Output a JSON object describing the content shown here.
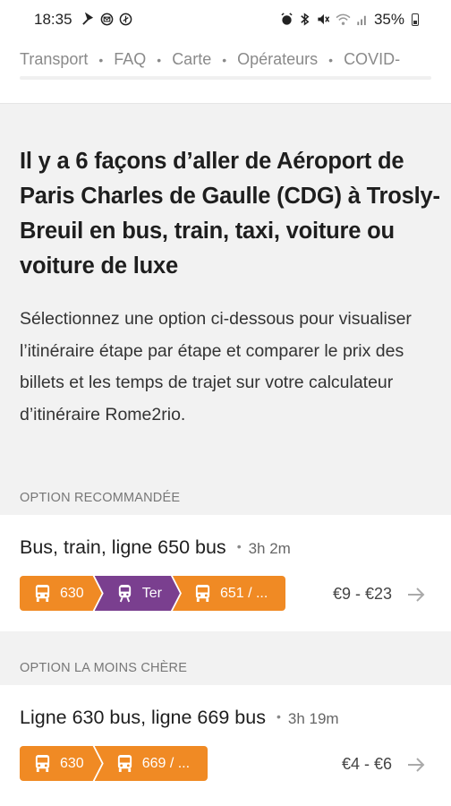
{
  "status_bar": {
    "time": "18:35",
    "left_icons": [
      "signal-tower-icon",
      "mail-icon",
      "sync-icon"
    ],
    "right_icons": [
      "alarm-icon",
      "bluetooth-icon",
      "mute-icon",
      "wifi-icon",
      "cell-signal-icon"
    ],
    "battery": "35%"
  },
  "nav": {
    "items": [
      "Transport",
      "FAQ",
      "Carte",
      "Opérateurs",
      "COVID-"
    ]
  },
  "headline": "Il y a 6 façons d’aller de Aéroport de Paris Charles de Gaulle (CDG) à Trosly-Breuil en bus, train, taxi, voiture ou voiture de luxe",
  "intro": "Sélectionnez une option ci-dessous pour visualiser l’itinéraire étape par étape et comparer le prix des billets et les temps de trajet sur votre calculateur d’itinéraire Rome2rio.",
  "options": [
    {
      "section_label": "OPTION RECOMMANDÉE",
      "title": "Bus, train, ligne 650 bus",
      "duration": "3h 2m",
      "price": "€9 - €23",
      "segments": [
        {
          "icon": "bus-icon",
          "label": "630",
          "color": "#f08a24"
        },
        {
          "icon": "train-icon",
          "label": "Ter",
          "color": "#7a3f8f"
        },
        {
          "icon": "bus-icon",
          "label": "651 / ...",
          "color": "#f08a24"
        }
      ]
    },
    {
      "section_label": "OPTION LA MOINS CHÈRE",
      "title": "Ligne 630 bus, ligne 669 bus",
      "duration": "3h 19m",
      "price": "€4 - €6",
      "segments": [
        {
          "icon": "bus-icon",
          "label": "630",
          "color": "#f08a24"
        },
        {
          "icon": "bus-icon",
          "label": "669 / ...",
          "color": "#f08a24"
        }
      ]
    }
  ]
}
